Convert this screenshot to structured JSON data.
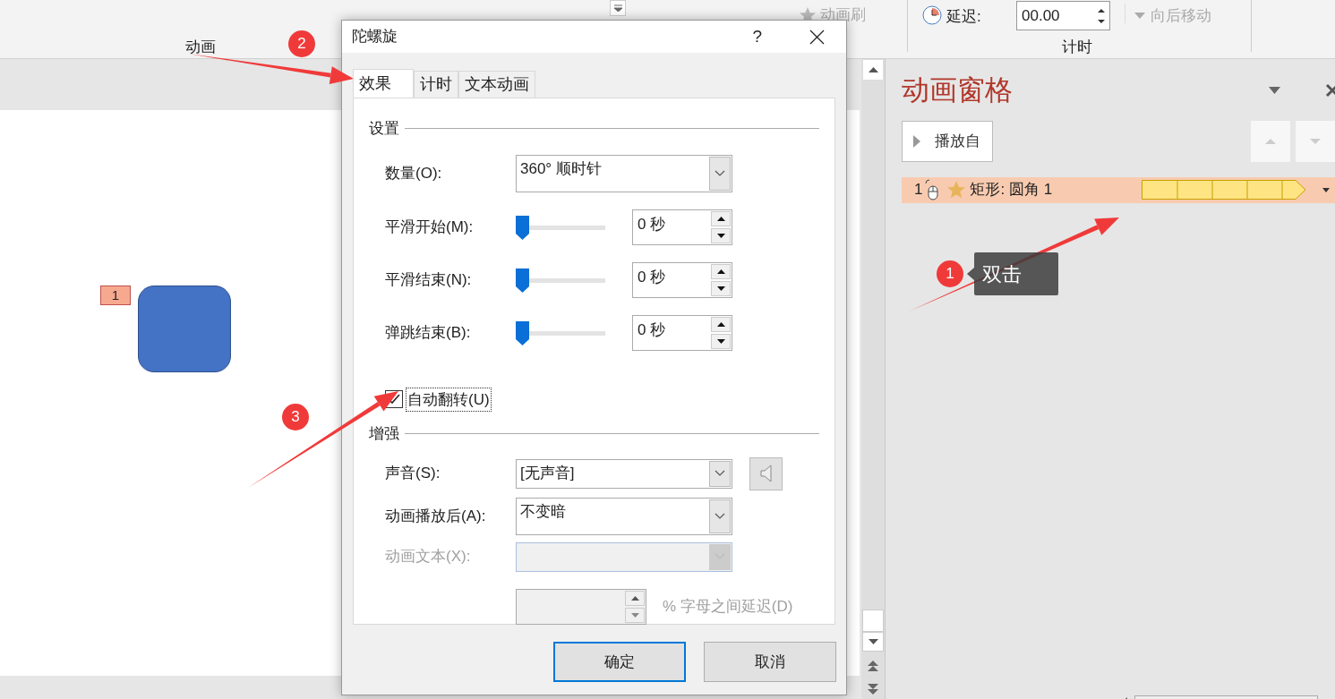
{
  "ribbon": {
    "animation_painter": {
      "label": "动画刷",
      "disabled": true
    },
    "group_labels": [
      "动画",
      "计时"
    ],
    "delay": {
      "label": "延迟:",
      "value": "00.00"
    },
    "move_later": {
      "label": "向后移动",
      "disabled": true
    }
  },
  "slide": {
    "tag": "1"
  },
  "animation_pane": {
    "title": "动画窗格",
    "play_button": "播放自",
    "items": [
      {
        "index": "1",
        "name": "矩形: 圆角 1",
        "selected": true
      }
    ]
  },
  "dialog": {
    "title": "陀螺旋",
    "help": "?",
    "tabs": [
      {
        "label": "效果",
        "selected": true
      },
      {
        "label": "计时",
        "selected": false
      },
      {
        "label": "文本动画",
        "selected": false
      }
    ],
    "settings": {
      "heading": "设置",
      "rows": [
        {
          "kind": "dropdown",
          "label": "数量(O):",
          "value": "360° 顺时针"
        },
        {
          "kind": "slider",
          "label": "平滑开始(M):",
          "level": 0,
          "value": "0 秒"
        },
        {
          "kind": "slider",
          "label": "平滑结束(N):",
          "level": 0,
          "value": "0 秒"
        },
        {
          "kind": "slider",
          "label": "弹跳结束(B):",
          "level": 0,
          "value": "0 秒"
        }
      ],
      "auto_reverse": {
        "label": "自动翻转(U)",
        "checked": true
      }
    },
    "enhancements": {
      "heading": "增强",
      "rows": [
        {
          "kind": "sound",
          "label": "声音(S):",
          "value": "[无声音]",
          "disabled": false
        },
        {
          "kind": "dropdown",
          "label": "动画播放后(A):",
          "value": "不变暗",
          "disabled": false
        },
        {
          "kind": "dropdown",
          "label": "动画文本(X):",
          "disabled": true
        }
      ],
      "letter_delay": {
        "label": "% 字母之间延迟(D)",
        "disabled": true
      }
    },
    "buttons": [
      {
        "label": "确定",
        "default": true
      },
      {
        "label": "取消",
        "default": false
      }
    ]
  },
  "annotations": [
    {
      "number": "2"
    },
    {
      "number": "1",
      "note": "双击"
    },
    {
      "number": "3"
    }
  ]
}
